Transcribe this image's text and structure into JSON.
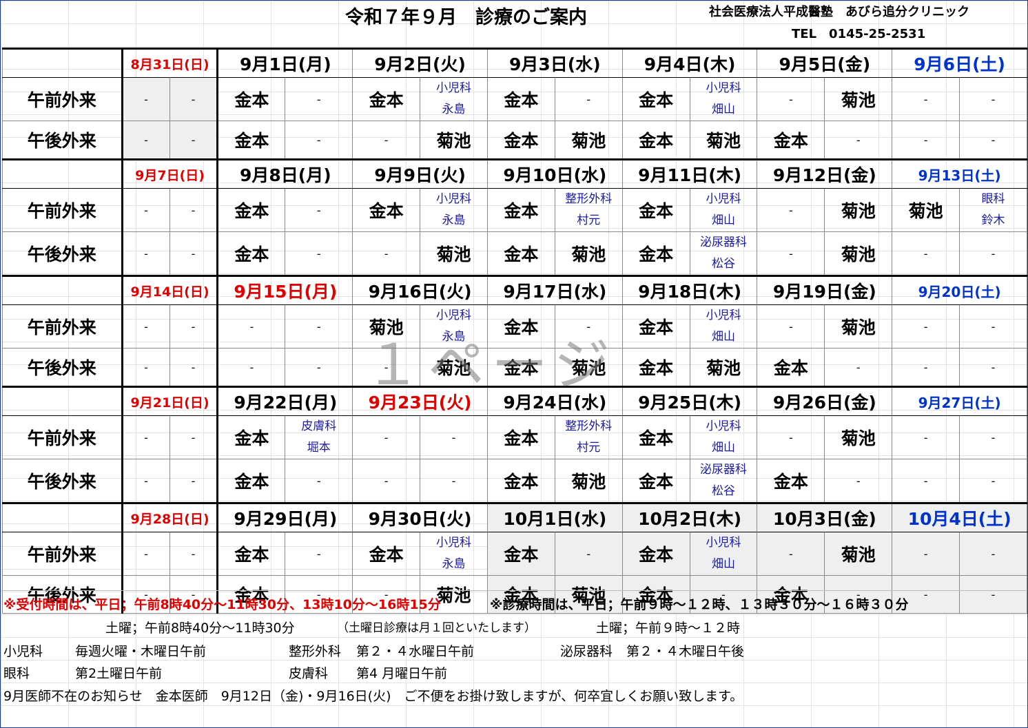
{
  "header": {
    "title": "令和７年９月　診療のご案内",
    "clinic": "社会医療法人平成醫塾　あびら追分クリニック",
    "tel": "TEL　0145-25-2531"
  },
  "row_labels": {
    "am": "午前外来",
    "pm": "午後外来"
  },
  "weeks": [
    {
      "dates": [
        "8月31日(日)",
        "9月1日(月)",
        "9月2日(火)",
        "9月3日(水)",
        "9月4日(木)",
        "9月5日(金)",
        "9月6日(土)"
      ],
      "am": [
        "-",
        "-",
        "金本",
        "-",
        "金本",
        "小児科\n永島",
        "金本",
        "-",
        "金本",
        "小児科\n畑山",
        "-",
        "菊池",
        "-",
        "-"
      ],
      "pm": [
        "-",
        "-",
        "金本",
        "-",
        "-",
        "菊池",
        "金本",
        "菊池",
        "金本",
        "菊池",
        "金本",
        "-",
        "-",
        "-"
      ]
    },
    {
      "dates": [
        "9月7日(日)",
        "9月8日(月)",
        "9月9日(火)",
        "9月10日(水)",
        "9月11日(木)",
        "9月12日(金)",
        "9月13日(土)"
      ],
      "am": [
        "-",
        "-",
        "金本",
        "-",
        "金本",
        "小児科\n永島",
        "金本",
        "整形外科\n村元",
        "金本",
        "小児科\n畑山",
        "-",
        "菊池",
        "菊池",
        "眼科\n鈴木"
      ],
      "pm": [
        "-",
        "-",
        "金本",
        "-",
        "-",
        "菊池",
        "金本",
        "菊池",
        "金本",
        "泌尿器科\n松谷",
        "-",
        "菊池",
        "-",
        "-"
      ]
    },
    {
      "dates": [
        "9月14日(日)",
        "9月15日(月)",
        "9月16日(火)",
        "9月17日(水)",
        "9月18日(木)",
        "9月19日(金)",
        "9月20日(土)"
      ],
      "am": [
        "-",
        "-",
        "-",
        "-",
        "菊池",
        "小児科\n永島",
        "金本",
        "-",
        "金本",
        "小児科\n畑山",
        "-",
        "菊池",
        "-",
        "-"
      ],
      "pm": [
        "-",
        "-",
        "-",
        "-",
        "-",
        "菊池",
        "金本",
        "菊池",
        "金本",
        "菊池",
        "金本",
        "-",
        "-",
        "-"
      ]
    },
    {
      "dates": [
        "9月21日(日)",
        "9月22日(月)",
        "9月23日(火)",
        "9月24日(水)",
        "9月25日(木)",
        "9月26日(金)",
        "9月27日(土)"
      ],
      "am": [
        "-",
        "-",
        "金本",
        "皮膚科\n堀本",
        "-",
        "-",
        "金本",
        "整形外科\n村元",
        "金本",
        "小児科\n畑山",
        "-",
        "菊池",
        "-",
        "-"
      ],
      "pm": [
        "-",
        "-",
        "金本",
        "-",
        "-",
        "-",
        "金本",
        "菊池",
        "金本",
        "泌尿器科\n松谷",
        "金本",
        "-",
        "-",
        "-"
      ]
    },
    {
      "dates": [
        "9月28日(日)",
        "9月29日(月)",
        "9月30日(火)",
        "10月1日(水)",
        "10月2日(木)",
        "10月3日(金)",
        "10月4日(土)"
      ],
      "am": [
        "-",
        "-",
        "金本",
        "-",
        "金本",
        "小児科\n永島",
        "金本",
        "-",
        "金本",
        "小児科\n畑山",
        "-",
        "菊池",
        "-",
        "-"
      ],
      "pm": [
        "-",
        "-",
        "金本",
        "-",
        "-",
        "菊池",
        "金本",
        "菊池",
        "金本",
        "-",
        "金本",
        "-",
        "-",
        "-"
      ]
    }
  ],
  "watermark": "１ページ",
  "notes": {
    "reception_weekday": "※受付時間は、平日；午前8時40分～11時30分、13時10分～16時15分",
    "consult_weekday": "※診療時間は、平日；午前９時～１２時、１３時３０分～１６時３０分",
    "reception_sat": "土曜；午前8時40分～11時30分",
    "sat_note": "（土曜日診療は月１回といたします）",
    "consult_sat": "土曜；午前９時～１２時",
    "pediatrics_label": "小児科",
    "pediatrics_value": "毎週火曜・木曜日午前",
    "ortho_label": "整形外科",
    "ortho_value": "第２・４水曜日午前",
    "urology_label": "泌尿器科",
    "urology_value": "第２・４木曜日午後",
    "ophth_label": "眼科",
    "ophth_value": "第2土曜日午前",
    "derm_label": "皮膚科",
    "derm_value": "第4 月曜日午前",
    "absence": "9月医師不在のお知らせ　金本医師　9月12日（金)・9月16日(火)　ご不便をお掛け致しますが、何卒宜しくお願い致します。"
  },
  "colors": {
    "holiday_red": "#e00000",
    "saturday_blue": "#0033cc",
    "specialty_blue": "#1a1aa0",
    "grey_cell": "#efefef"
  }
}
